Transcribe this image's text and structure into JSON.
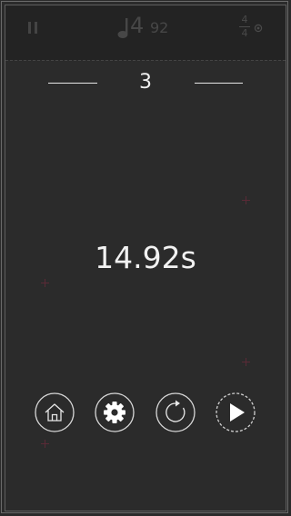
{
  "hud": {
    "tempo_integer": "4",
    "tempo_decimal": "92",
    "time_signature_top": "4",
    "time_signature_bottom": "4",
    "icons": [
      "pause-icon",
      "music-note-icon",
      "metronome-dot-icon"
    ]
  },
  "level": {
    "number": "3"
  },
  "result": {
    "time_text": "14.92s"
  },
  "buttons": [
    {
      "name": "home-button",
      "icon": "home-icon"
    },
    {
      "name": "settings-button",
      "icon": "gear-icon"
    },
    {
      "name": "restart-button",
      "icon": "restart-icon"
    },
    {
      "name": "play-button",
      "icon": "play-icon"
    }
  ],
  "colors": {
    "background": "#2b2b2b",
    "hud_background": "#232323",
    "foreground": "#f0f0f0",
    "dim_hud": "#474747",
    "sparkle": "#6b2a3a"
  }
}
